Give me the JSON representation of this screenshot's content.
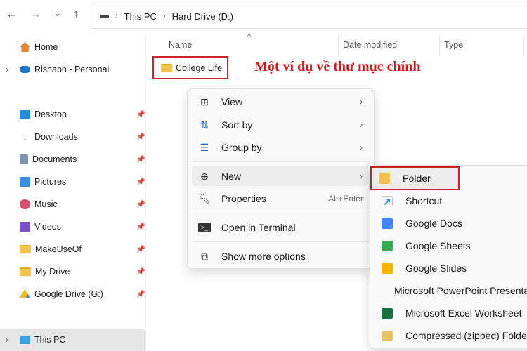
{
  "toolbar": {
    "back": "←",
    "forward": "→",
    "recent": "⌄",
    "up": "↑"
  },
  "address": {
    "crumbs": [
      "This PC",
      "Hard Drive (D:)"
    ]
  },
  "sidebar": {
    "items": [
      {
        "label": "Home",
        "icon": "home-icon"
      },
      {
        "label": "Rishabh - Personal",
        "icon": "onedrive-icon"
      },
      {
        "label": "Desktop",
        "icon": "desktop-icon"
      },
      {
        "label": "Downloads",
        "icon": "download-icon"
      },
      {
        "label": "Documents",
        "icon": "documents-icon"
      },
      {
        "label": "Pictures",
        "icon": "pictures-icon"
      },
      {
        "label": "Music",
        "icon": "music-icon"
      },
      {
        "label": "Videos",
        "icon": "videos-icon"
      },
      {
        "label": "MakeUseOf",
        "icon": "folder-icon"
      },
      {
        "label": "My Drive",
        "icon": "folder-icon"
      },
      {
        "label": "Google Drive (G:)",
        "icon": "google-drive-icon"
      },
      {
        "label": "This PC",
        "icon": "pc-icon"
      }
    ]
  },
  "columns": {
    "name": "Name",
    "date": "Date modified",
    "type": "Type"
  },
  "files": [
    {
      "name": "College Life"
    }
  ],
  "annotation": "Một ví dụ về thư mục chính",
  "context_menu": {
    "items": [
      {
        "label": "View",
        "icon": "grid-icon"
      },
      {
        "label": "Sort by",
        "icon": "sort-icon"
      },
      {
        "label": "Group by",
        "icon": "group-icon"
      },
      {
        "label": "New",
        "icon": "plus-circle-icon"
      },
      {
        "label": "Properties",
        "icon": "wrench-icon",
        "shortcut": "Alt+Enter"
      },
      {
        "label": "Open in Terminal",
        "icon": "terminal-icon"
      },
      {
        "label": "Show more options",
        "icon": "more-options-icon"
      }
    ]
  },
  "submenu": {
    "items": [
      {
        "label": "Folder",
        "color": "#f2c14e"
      },
      {
        "label": "Shortcut",
        "color": "#2a7fd4"
      },
      {
        "label": "Google Docs",
        "color": "#4285f4"
      },
      {
        "label": "Google Sheets",
        "color": "#34a853"
      },
      {
        "label": "Google Slides",
        "color": "#f4b400"
      },
      {
        "label": "Microsoft PowerPoint Presentation",
        "color": "#c43e1c"
      },
      {
        "label": "Microsoft Excel Worksheet",
        "color": "#1d6f42"
      },
      {
        "label": "Compressed (zipped) Folder",
        "color": "#e8c36a"
      }
    ]
  },
  "highlight_color": "#c8222a"
}
